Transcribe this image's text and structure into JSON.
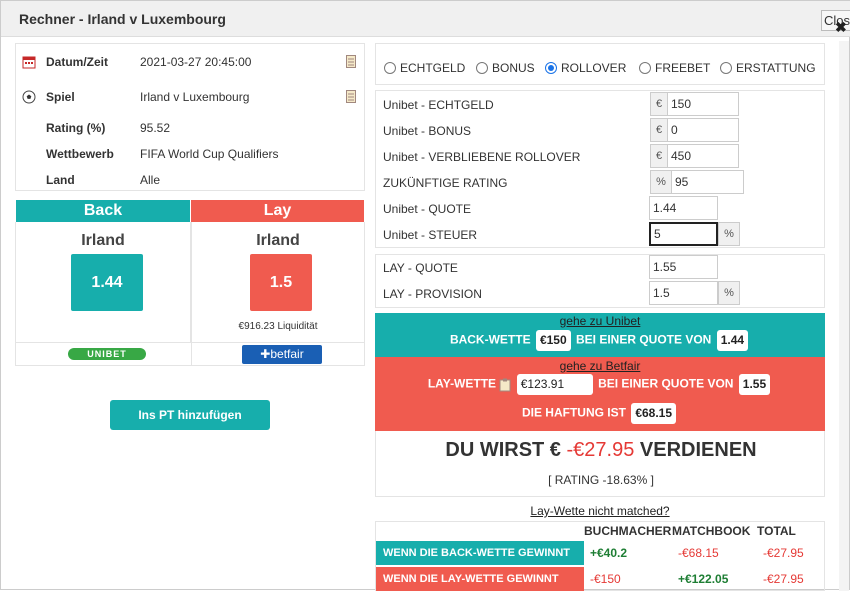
{
  "modal": {
    "title": "Rechner - Irland v Luxembourg",
    "close_label": "Close",
    "close_symbol": "✖"
  },
  "info": {
    "rows": [
      {
        "icon": "calendar-icon",
        "label": "Datum/Zeit",
        "value": "2021-03-27 20:45:00"
      },
      {
        "icon": "football-icon",
        "label": "Spiel",
        "value": "Irland v Luxembourg"
      },
      {
        "label": "Rating (%)",
        "value": "95.52"
      },
      {
        "label": "Wettbewerb",
        "value": "FIFA World Cup Qualifiers"
      },
      {
        "label": "Land",
        "value": "Alle"
      }
    ]
  },
  "back": {
    "header": "Back",
    "team": "Irland",
    "odds": "1.44",
    "bookmaker": "UNIBET",
    "color": "#17aeac"
  },
  "lay": {
    "header": "Lay",
    "team": "Irland",
    "odds": "1.5",
    "liquidity": "€916.23 Liquidität",
    "exchange": "betfair",
    "color": "#f05b4f"
  },
  "add_pt_button": "Ins PT hinzufügen",
  "bet_types": [
    {
      "label": "ECHTGELD",
      "checked": false
    },
    {
      "label": "BONUS",
      "checked": false
    },
    {
      "label": "ROLLOVER",
      "checked": true
    },
    {
      "label": "FREEBET",
      "checked": false
    },
    {
      "label": "ERSTATTUNG",
      "checked": false
    }
  ],
  "form": {
    "echtgeld": {
      "label": "Unibet - ECHTGELD",
      "prefix": "€",
      "value": "150"
    },
    "bonus": {
      "label": "Unibet - BONUS",
      "prefix": "€",
      "value": "0"
    },
    "rollover": {
      "label": "Unibet - VERBLIEBENE ROLLOVER",
      "prefix": "€",
      "value": "450"
    },
    "rating": {
      "label": "ZUKÜNFTIGE RATING",
      "prefix": "%",
      "value": "95"
    },
    "quote": {
      "label": "Unibet - QUOTE",
      "value": "1.44"
    },
    "steuer": {
      "label": "Unibet - STEUER",
      "value": "5",
      "suffix": "%"
    },
    "lay_quote": {
      "label": "LAY - QUOTE",
      "value": "1.55"
    },
    "lay_provision": {
      "label": "LAY - PROVISION",
      "value": "1.5",
      "suffix": "%"
    }
  },
  "summary": {
    "back_link": "gehe zu Unibet",
    "back_text1": "BACK-WETTE",
    "back_stake": "€150",
    "back_text2": "BEI EINER QUOTE VON",
    "back_odds": "1.44",
    "lay_link": "gehe zu Betfair",
    "lay_text1": "LAY-WETTE",
    "lay_stake": "€123.91",
    "lay_text2": "BEI EINER QUOTE VON",
    "lay_odds": "1.55",
    "liability_text": "DIE HAFTUNG IST",
    "liability": "€68.15"
  },
  "result": {
    "prefix": "DU WIRST €",
    "amount": "-€27.95",
    "suffix": "VERDIENEN",
    "rating": "[ RATING -18.63% ]"
  },
  "not_matched_link": "Lay-Wette nicht matched?",
  "outcome_table": {
    "headers": [
      "BUCHMACHER",
      "MATCHBOOK",
      "TOTAL"
    ],
    "rows": [
      {
        "label": "WENN DIE BACK-WETTE GEWINNT",
        "bookmaker": "+€40.2",
        "matchbook": "-€68.15",
        "total": "-€27.95"
      },
      {
        "label": "WENN DIE LAY-WETTE GEWINNT",
        "bookmaker": "-€150",
        "matchbook": "+€122.05",
        "total": "-€27.95"
      }
    ]
  }
}
